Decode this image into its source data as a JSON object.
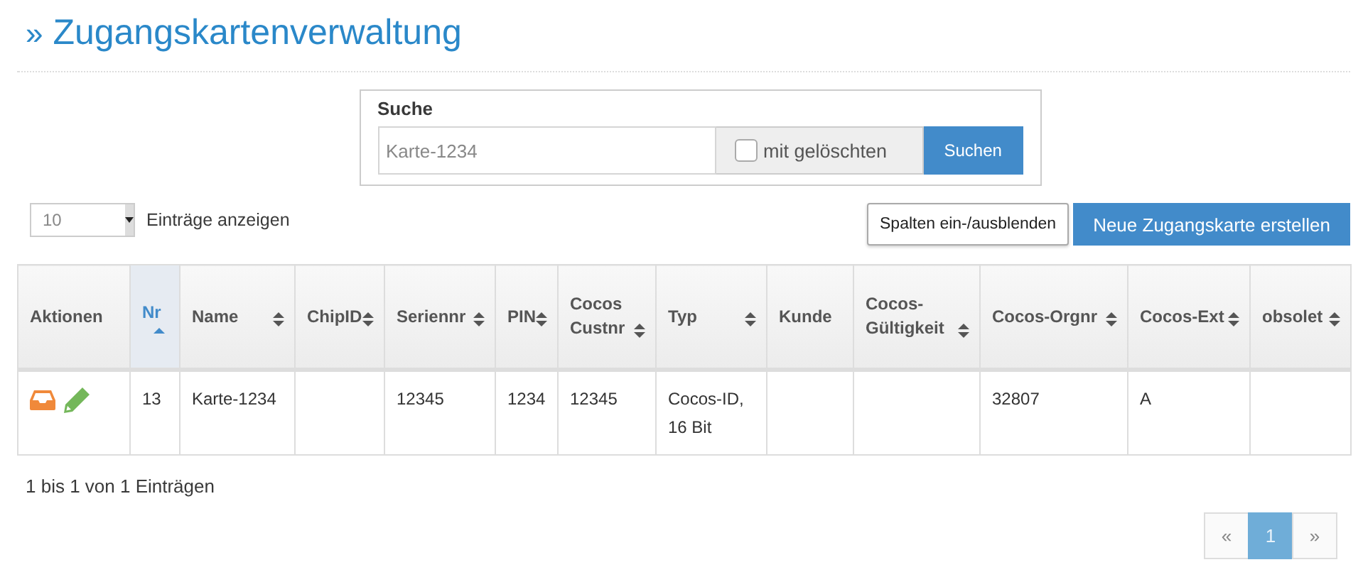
{
  "title_mark": "»",
  "title": "Zugangskartenverwaltung",
  "search": {
    "label": "Suche",
    "placeholder": "Karte-1234",
    "deleted_label": "mit gelöschten",
    "deleted_checked": false,
    "button": "Suchen"
  },
  "page_size": {
    "value": "10",
    "label": "Einträge anzeigen"
  },
  "buttons": {
    "columns": "Spalten ein-/ausblenden",
    "create": "Neue Zugangskarte erstellen"
  },
  "table": {
    "columns": [
      {
        "label": "Aktionen",
        "kind": "plain"
      },
      {
        "label": "Nr",
        "kind": "sorted"
      },
      {
        "label": "Name",
        "kind": "sortable"
      },
      {
        "label": "ChipID",
        "kind": "sortable"
      },
      {
        "label": "Seriennr",
        "kind": "sortable"
      },
      {
        "label": "PIN",
        "kind": "sortable"
      },
      {
        "label": "Cocos Custnr",
        "kind": "sortable"
      },
      {
        "label": "Typ",
        "kind": "sortable"
      },
      {
        "label": "Kunde",
        "kind": "plain"
      },
      {
        "label": "Cocos-Gültigkeit",
        "kind": "sortable"
      },
      {
        "label": "Cocos-Orgnr",
        "kind": "sortable"
      },
      {
        "label": "Cocos-Ext",
        "kind": "sortable"
      },
      {
        "label": "obsolet",
        "kind": "sortable"
      }
    ],
    "rows": [
      {
        "cells": [
          null,
          "13",
          "Karte-1234",
          null,
          "12345",
          "1234",
          "12345",
          "Cocos-ID, 16 Bit",
          null,
          null,
          "32807",
          "A",
          null
        ]
      }
    ]
  },
  "info": "1 bis 1 von 1 Einträgen",
  "pagination": [
    {
      "label": "«",
      "selected": false
    },
    {
      "label": "1",
      "selected": true
    },
    {
      "label": "»",
      "selected": false
    }
  ]
}
